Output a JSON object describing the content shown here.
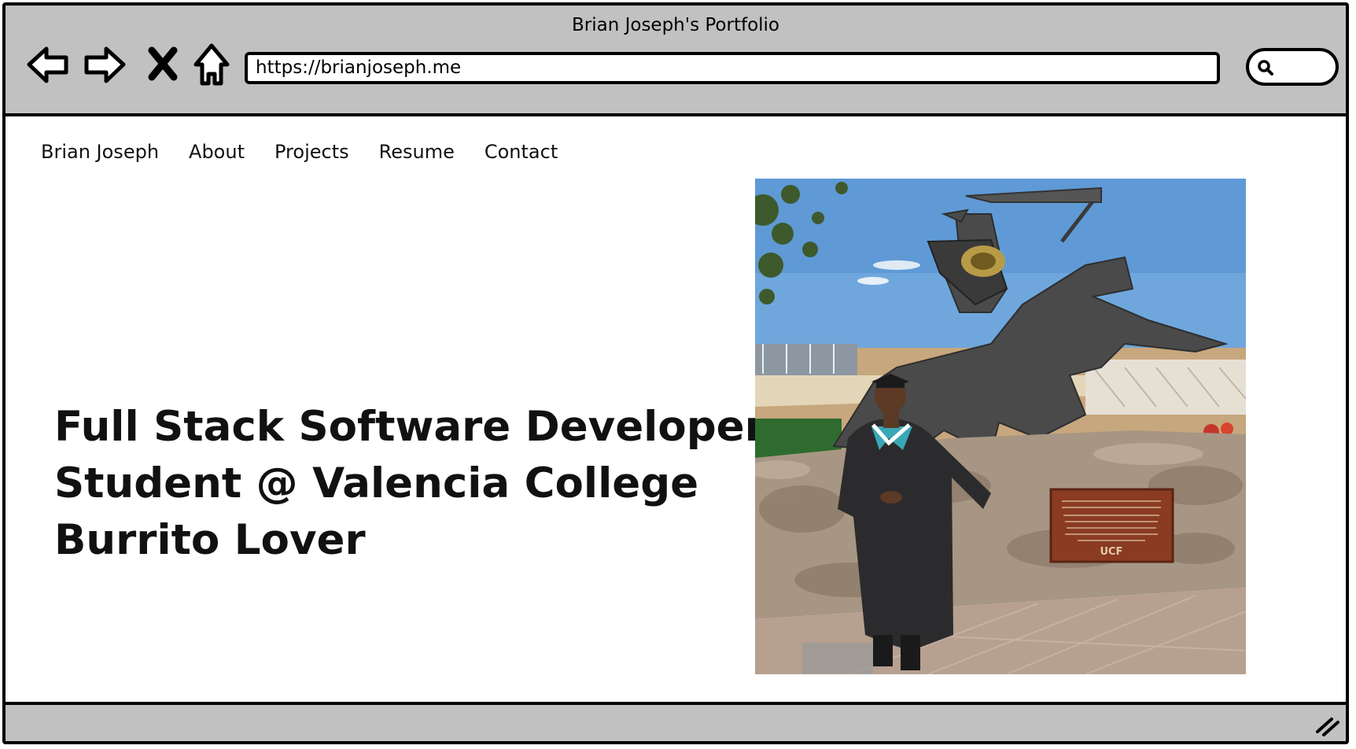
{
  "window": {
    "title": "Brian Joseph's Portfolio"
  },
  "toolbar": {
    "back_icon": "back-arrow-icon",
    "forward_icon": "forward-arrow-icon",
    "stop_icon": "close-x-icon",
    "home_icon": "home-icon",
    "url": "https://brianjoseph.me",
    "search_icon": "search-icon"
  },
  "nav": {
    "items": [
      {
        "label": "Brian Joseph"
      },
      {
        "label": "About"
      },
      {
        "label": "Projects"
      },
      {
        "label": "Resume"
      },
      {
        "label": "Contact"
      }
    ]
  },
  "hero": {
    "lines": [
      "Full Stack Software Developer",
      "Student @ Valencia College",
      "Burrito Lover"
    ]
  },
  "photo": {
    "plaque_logo": "UCF"
  }
}
